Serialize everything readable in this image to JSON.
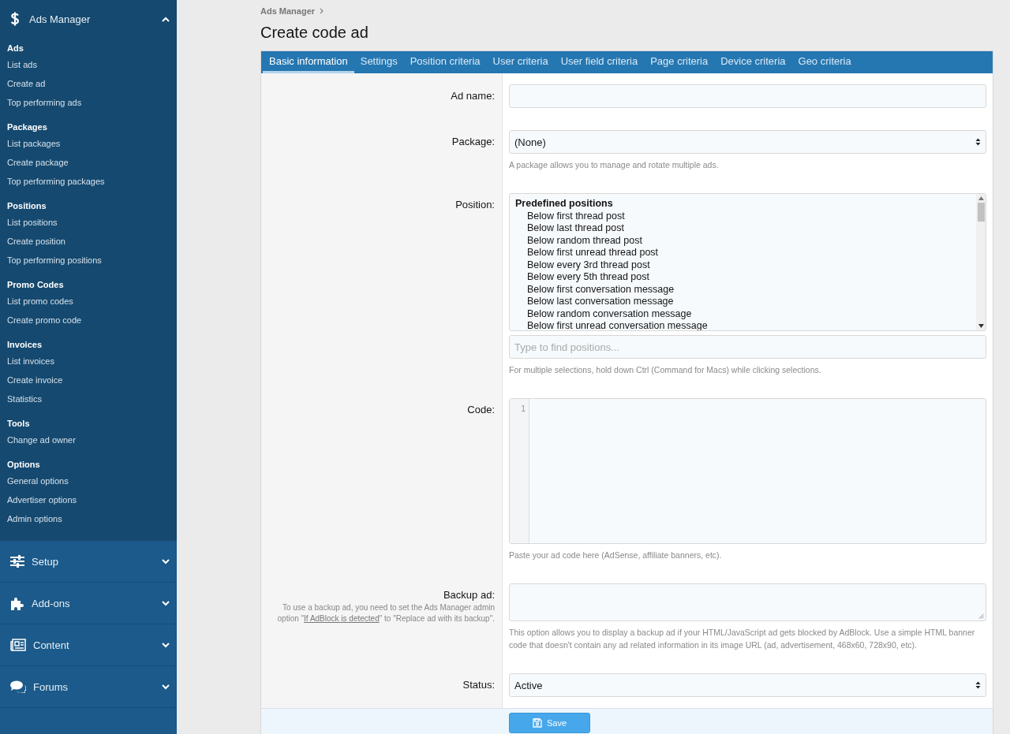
{
  "sidebar": {
    "header": {
      "kind": "dollar",
      "label": "Ads Manager",
      "expanded": true
    },
    "groups": [
      {
        "title": "Ads",
        "items": [
          "List ads",
          "Create ad",
          "Top performing ads"
        ]
      },
      {
        "title": "Packages",
        "items": [
          "List packages",
          "Create package",
          "Top performing packages"
        ]
      },
      {
        "title": "Positions",
        "items": [
          "List positions",
          "Create position",
          "Top performing positions"
        ]
      },
      {
        "title": "Promo Codes",
        "items": [
          "List promo codes",
          "Create promo code"
        ]
      },
      {
        "title": "Invoices",
        "items": [
          "List invoices",
          "Create invoice",
          "Statistics"
        ]
      },
      {
        "title": "Tools",
        "items": [
          "Change ad owner"
        ]
      },
      {
        "title": "Options",
        "items": [
          "General options",
          "Advertiser options",
          "Admin options"
        ]
      }
    ],
    "sections": [
      {
        "kind": "sliders",
        "label": "Setup",
        "expanded": false
      },
      {
        "kind": "puzzle",
        "label": "Add-ons",
        "expanded": false
      },
      {
        "kind": "newspaper",
        "label": "Content",
        "expanded": false
      },
      {
        "kind": "comments",
        "label": "Forums",
        "expanded": false
      }
    ]
  },
  "breadcrumb": [
    "Ads Manager"
  ],
  "page_title": "Create code ad",
  "tabs": [
    {
      "label": "Basic information",
      "selected": true
    },
    {
      "label": "Settings",
      "selected": false
    },
    {
      "label": "Position criteria",
      "selected": false
    },
    {
      "label": "User criteria",
      "selected": false
    },
    {
      "label": "User field criteria",
      "selected": false
    },
    {
      "label": "Page criteria",
      "selected": false
    },
    {
      "label": "Device criteria",
      "selected": false
    },
    {
      "label": "Geo criteria",
      "selected": false
    }
  ],
  "form": [
    {
      "kind": "text",
      "label": "Ad name:"
    },
    {
      "kind": "select",
      "label": "Package:",
      "value": "(None)",
      "hint": "A package allows you to manage and rotate multiple ads."
    },
    {
      "kind": "listbox",
      "label": "Position:",
      "group": "Predefined positions",
      "options": [
        "Below first thread post",
        "Below last thread post",
        "Below random thread post",
        "Below first unread thread post",
        "Below every 3rd thread post",
        "Below every 5th thread post",
        "Below first conversation message",
        "Below last conversation message",
        "Below random conversation message",
        "Below first unread conversation message"
      ],
      "search_placeholder": "Type to find positions...",
      "hint": "For multiple selections, hold down Ctrl (Command for Macs) while clicking selections."
    },
    {
      "kind": "code",
      "label": "Code:",
      "line_number": "1",
      "hint": "Paste your ad code here (AdSense, affiliate banners, etc)."
    },
    {
      "kind": "textarea",
      "label": "Backup ad:",
      "explain": {
        "before": "To use a backup ad, you need to set the Ads Manager admin option \"",
        "link": "If AdBlock is detected",
        "after": "\" to \"Replace ad with its backup\"."
      },
      "hint": "This option allows you to display a backup ad if your HTML/JavaScript ad gets blocked by AdBlock. Use a simple HTML banner code that doesn't contain any ad related information in its image URL (ad, advertisement, 468x60, 728x90, etc)."
    },
    {
      "kind": "select",
      "label": "Status:",
      "value": "Active"
    }
  ],
  "save_button": "Save"
}
